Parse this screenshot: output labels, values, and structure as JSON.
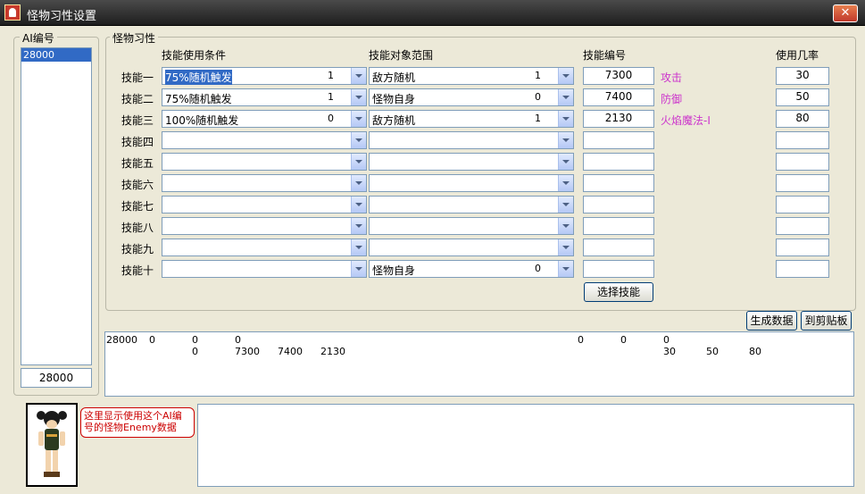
{
  "window": {
    "title": "怪物习性设置",
    "close_label": "✕"
  },
  "ai_panel": {
    "legend": "AI编号",
    "items": [
      "28000"
    ],
    "selected_index": 0,
    "current_value": "28000"
  },
  "skills_panel": {
    "legend": "怪物习性",
    "headers": {
      "condition": "技能使用条件",
      "target": "技能对象范围",
      "skill_id": "技能编号",
      "probability": "使用几率"
    },
    "rows": [
      {
        "label": "技能一",
        "condition": "75%随机触发",
        "condition_code": "1",
        "target": "敌方随机",
        "target_code": "1",
        "skill_id": "7300",
        "skill_name": "攻击",
        "probability": "30"
      },
      {
        "label": "技能二",
        "condition": "75%随机触发",
        "condition_code": "1",
        "target": "怪物自身",
        "target_code": "0",
        "skill_id": "7400",
        "skill_name": "防御",
        "probability": "50"
      },
      {
        "label": "技能三",
        "condition": "100%随机触发",
        "condition_code": "0",
        "target": "敌方随机",
        "target_code": "1",
        "skill_id": "2130",
        "skill_name": "火焰魔法-Ⅰ",
        "probability": "80"
      },
      {
        "label": "技能四",
        "condition": "",
        "condition_code": "",
        "target": "",
        "target_code": "",
        "skill_id": "",
        "skill_name": "",
        "probability": ""
      },
      {
        "label": "技能五",
        "condition": "",
        "condition_code": "",
        "target": "",
        "target_code": "",
        "skill_id": "",
        "skill_name": "",
        "probability": ""
      },
      {
        "label": "技能六",
        "condition": "",
        "condition_code": "",
        "target": "",
        "target_code": "",
        "skill_id": "",
        "skill_name": "",
        "probability": ""
      },
      {
        "label": "技能七",
        "condition": "",
        "condition_code": "",
        "target": "",
        "target_code": "",
        "skill_id": "",
        "skill_name": "",
        "probability": ""
      },
      {
        "label": "技能八",
        "condition": "",
        "condition_code": "",
        "target": "",
        "target_code": "",
        "skill_id": "",
        "skill_name": "",
        "probability": ""
      },
      {
        "label": "技能九",
        "condition": "",
        "condition_code": "",
        "target": "",
        "target_code": "",
        "skill_id": "",
        "skill_name": "",
        "probability": ""
      },
      {
        "label": "技能十",
        "condition": "",
        "condition_code": "",
        "target": "怪物自身",
        "target_code": "0",
        "skill_id": "",
        "skill_name": "",
        "probability": ""
      }
    ],
    "select_skill_button": "选择技能"
  },
  "actions": {
    "generate": "生成数据",
    "clipboard": "到剪贴板"
  },
  "output": {
    "line1": [
      "28000",
      "0",
      "0",
      "0",
      "0",
      "0",
      "0"
    ],
    "line2": [
      "0",
      "7300",
      "7400",
      "2130",
      "30",
      "50",
      "80"
    ]
  },
  "hint": "这里显示使用这个AI编号的怪物Enemy数据",
  "colors": {
    "skill_name": "#cc33cc",
    "selection": "#316ac5",
    "hint": "#cc0000"
  }
}
